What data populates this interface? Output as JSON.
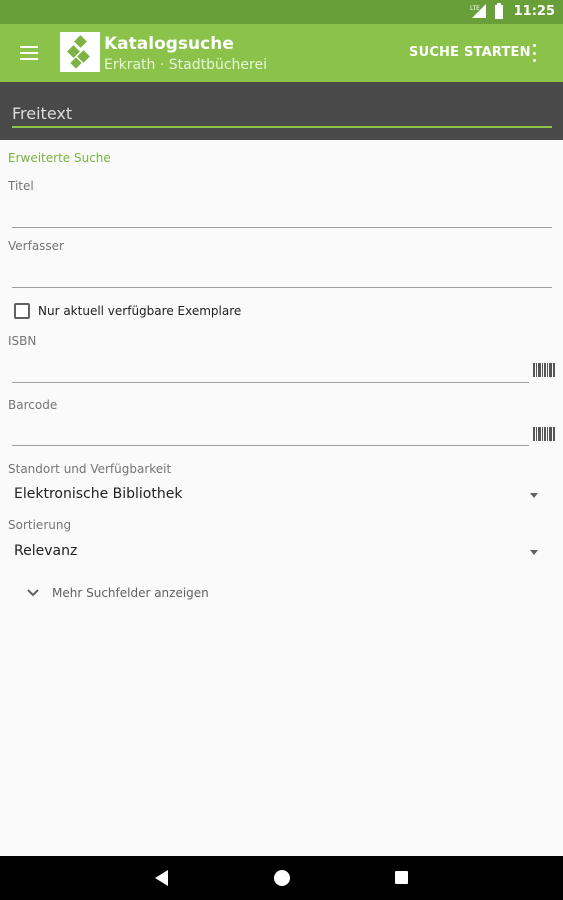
{
  "status_bar": {
    "network_label": "LTE",
    "time": "11:25"
  },
  "toolbar": {
    "title": "Katalogsuche",
    "subtitle": "Erkrath · Stadtbücherei",
    "action_label": "SUCHE STARTEN",
    "background_color": "#8bc34a",
    "status_bar_color": "#689f38"
  },
  "freetext": {
    "placeholder": "Freitext",
    "value": ""
  },
  "form": {
    "section_header": "Erweiterte Suche",
    "title_field": {
      "label": "Titel",
      "value": ""
    },
    "author_field": {
      "label": "Verfasser",
      "value": ""
    },
    "available_only": {
      "label": "Nur aktuell verfügbare Exemplare",
      "checked": false
    },
    "isbn_field": {
      "label": "ISBN",
      "value": ""
    },
    "barcode_field": {
      "label": "Barcode",
      "value": ""
    },
    "location": {
      "label": "Standort und Verfügbarkeit",
      "selected": "Elektronische Bibliothek"
    },
    "sort": {
      "label": "Sortierung",
      "selected": "Relevanz"
    },
    "more_fields_label": "Mehr Suchfelder anzeigen"
  },
  "icons": {
    "menu": "hamburger-menu-icon",
    "overflow": "more-vert-icon",
    "barcode": "barcode-scan-icon",
    "expand": "chevron-down-icon",
    "dropdown": "arrow-drop-down-icon"
  }
}
